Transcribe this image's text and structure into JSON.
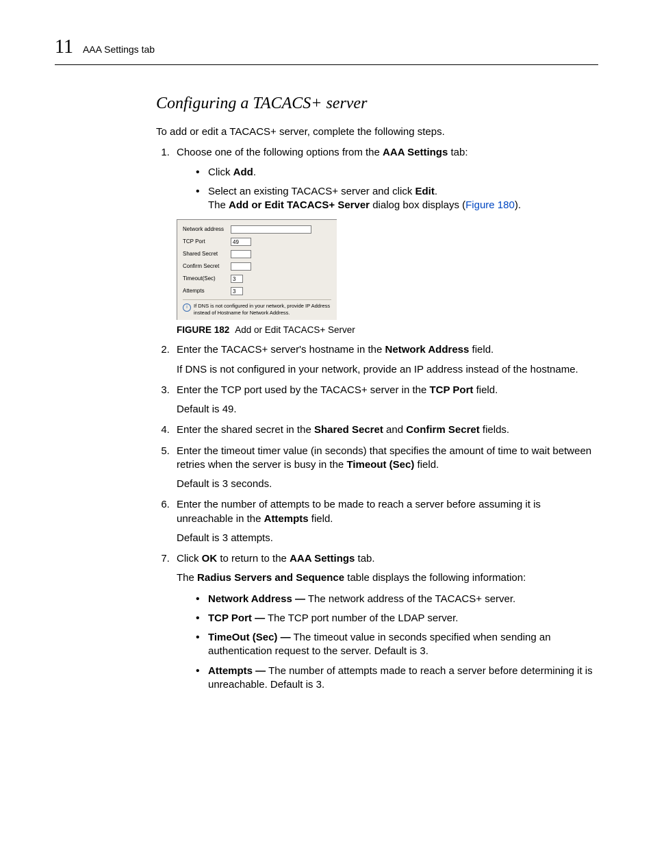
{
  "header": {
    "chapter_number": "11",
    "running_title": "AAA Settings tab"
  },
  "section_title": "Configuring a TACACS+ server",
  "intro": "To add or edit a TACACS+ server, complete the following steps.",
  "step1": {
    "lead": "Choose one of the following options from the ",
    "bold1": "AAA Settings",
    "tail": " tab:",
    "bullet1_lead": "Click ",
    "bullet1_bold": "Add",
    "bullet1_tail": ".",
    "bullet2_lead": "Select an existing TACACS+ server and click ",
    "bullet2_bold": "Edit",
    "bullet2_tail": ".",
    "sub_lead": "The ",
    "sub_bold": "Add or Edit TACACS+ Server",
    "sub_mid": " dialog box displays (",
    "sub_link": "Figure 180",
    "sub_tail": ")."
  },
  "dialog": {
    "labels": {
      "network_address": "Network address",
      "tcp_port": "TCP Port",
      "shared_secret": "Shared Secret",
      "confirm_secret": "Confirm Secret",
      "timeout": "Timeout(Sec)",
      "attempts": "Attempts"
    },
    "values": {
      "tcp_port": "49",
      "timeout": "3",
      "attempts": "3"
    },
    "note": "If DNS is not configured in your network, provide IP Address instead of Hostname for Network Address."
  },
  "figure": {
    "label": "FIGURE 182",
    "caption": "Add or Edit TACACS+ Server"
  },
  "step2": {
    "lead": "Enter the TACACS+ server's hostname in the ",
    "bold": "Network Address",
    "tail": " field.",
    "note": "If DNS is not configured in your network, provide an IP address instead of the hostname."
  },
  "step3": {
    "lead": "Enter the TCP port used by the TACACS+ server in the ",
    "bold": "TCP Port",
    "tail": " field.",
    "note": "Default is 49."
  },
  "step4": {
    "lead": "Enter the shared secret in the ",
    "bold1": "Shared Secret",
    "mid": " and ",
    "bold2": "Confirm Secret",
    "tail": " fields."
  },
  "step5": {
    "lead": "Enter the timeout timer value (in seconds) that specifies the amount of time to wait between retries when the server is busy in the ",
    "bold": "Timeout (Sec)",
    "tail": " field.",
    "note": "Default is 3 seconds."
  },
  "step6": {
    "lead": "Enter the number of attempts to be made to reach a server before assuming it is unreachable in the ",
    "bold": "Attempts",
    "tail": " field.",
    "note": "Default is 3 attempts."
  },
  "step7": {
    "lead": "Click ",
    "bold1": "OK",
    "mid": " to return to the ",
    "bold2": "AAA Settings",
    "tail": " tab.",
    "sub_lead": "The ",
    "sub_bold": "Radius Servers and Sequence",
    "sub_tail": " table displays the following information:",
    "bullets": {
      "b1_bold": "Network Address —",
      "b1_text": " The network address of the TACACS+ server.",
      "b2_bold": "TCP Port —",
      "b2_text": " The TCP port number of the LDAP server.",
      "b3_bold": "TimeOut (Sec) —",
      "b3_text": " The timeout value in seconds specified when sending an authentication request to the server. Default is 3.",
      "b4_bold": "Attempts —",
      "b4_text": " The number of attempts made to reach a server before determining it is unreachable. Default is 3."
    }
  }
}
